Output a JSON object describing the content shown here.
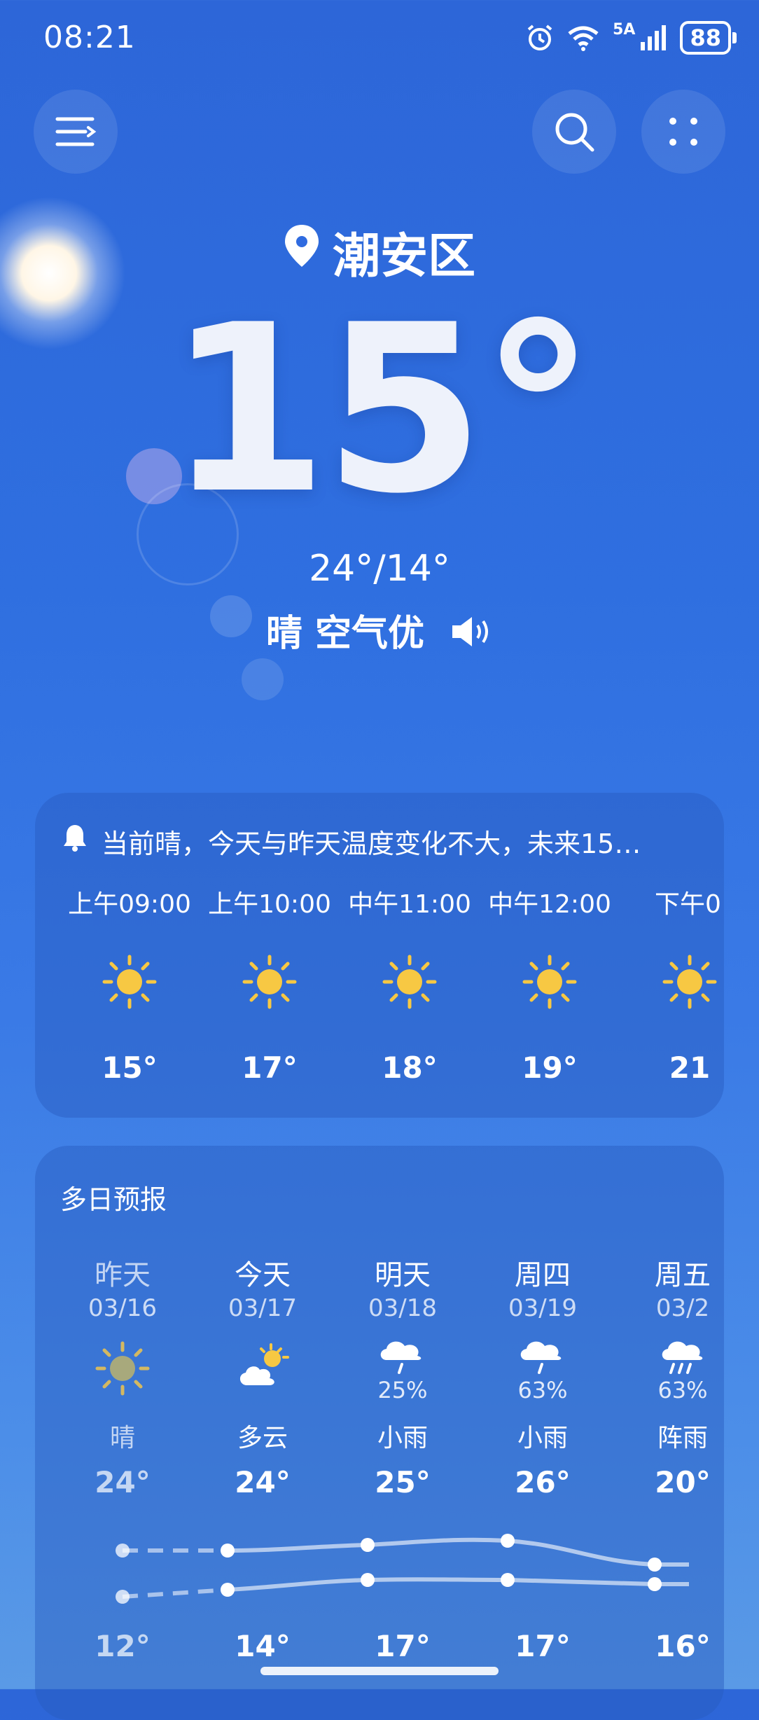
{
  "status_bar": {
    "time": "08:21",
    "network": "5A",
    "battery": "88"
  },
  "header": {
    "menu_icon": "menu-icon",
    "search_icon": "search-icon",
    "more_icon": "more-icon"
  },
  "current": {
    "location": "潮安区",
    "temperature": "15°",
    "high_low": "24°/14°",
    "condition": "晴 空气优"
  },
  "hourly": {
    "summary": "当前晴，今天与昨天温度变化不大，未来15…",
    "items": [
      {
        "time": "上午09:00",
        "temp": "15°",
        "icon": "sun-icon"
      },
      {
        "time": "上午10:00",
        "temp": "17°",
        "icon": "sun-icon"
      },
      {
        "time": "中午11:00",
        "temp": "18°",
        "icon": "sun-icon"
      },
      {
        "time": "中午12:00",
        "temp": "19°",
        "icon": "sun-icon"
      },
      {
        "time": "下午0",
        "temp": "21",
        "icon": "sun-icon"
      }
    ]
  },
  "daily": {
    "title": "多日预报",
    "items": [
      {
        "name": "昨天",
        "date": "03/16",
        "prob": "",
        "cond": "晴",
        "high": "24°",
        "low": "12°",
        "icon": "sun-icon"
      },
      {
        "name": "今天",
        "date": "03/17",
        "prob": "",
        "cond": "多云",
        "high": "24°",
        "low": "14°",
        "icon": "partly-cloudy-icon"
      },
      {
        "name": "明天",
        "date": "03/18",
        "prob": "25%",
        "cond": "小雨",
        "high": "25°",
        "low": "17°",
        "icon": "light-rain-icon"
      },
      {
        "name": "周四",
        "date": "03/19",
        "prob": "63%",
        "cond": "小雨",
        "high": "26°",
        "low": "17°",
        "icon": "light-rain-icon"
      },
      {
        "name": "周五",
        "date": "03/2",
        "prob": "63%",
        "cond": "阵雨",
        "high": "20°",
        "low": "16°",
        "icon": "shower-icon"
      }
    ]
  },
  "colors": {
    "sun_yellow": "#f7c843",
    "background_top": "#2d66d8",
    "background_bottom": "#5a9ae6"
  }
}
